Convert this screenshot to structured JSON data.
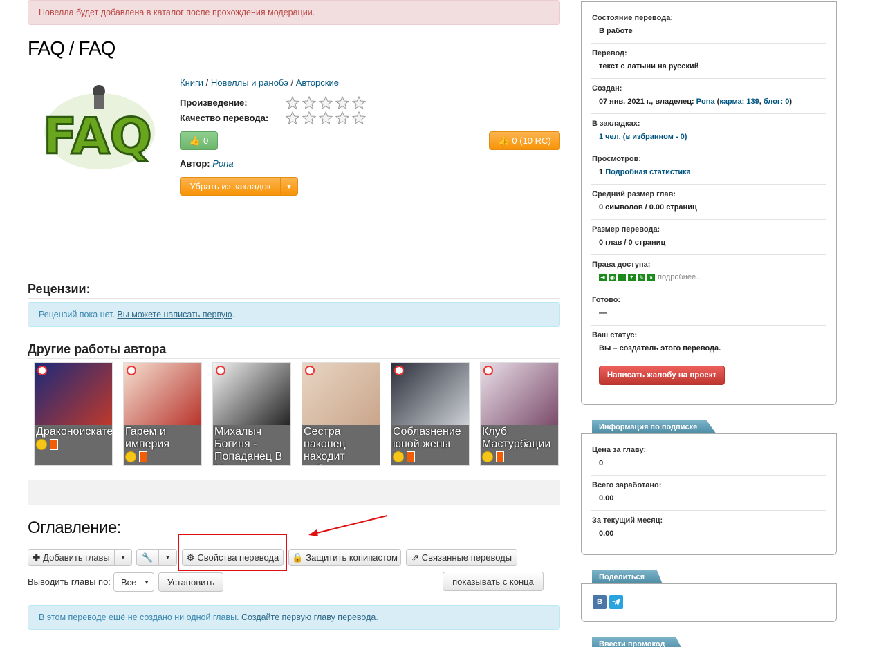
{
  "alerts": {
    "moderation": "Новелла будет добавлена в каталог после прохождения модерации.",
    "reviews_text": "Рецензий пока нет.",
    "reviews_link": "Вы можете написать первую",
    "reviews_end": ".",
    "chapters_text": "В этом переводе ещё не создано ни одной главы.",
    "chapters_link": "Создайте первую главу перевода",
    "chapters_end": "."
  },
  "title": "FAQ / FAQ",
  "breadcrumbs": {
    "c1": "Книги",
    "sep1": " / ",
    "c2": "Новеллы и ранобэ",
    "sep2": " / ",
    "c3": "Авторские"
  },
  "ratings": {
    "work_label": "Произведение:",
    "quality_label": "Качество перевода:"
  },
  "buttons": {
    "like": "0",
    "rc": "0 (10 RC)",
    "bookmark": "Убрать из закладок",
    "add_chapters": "Добавить главы",
    "properties": "Свойства перевода",
    "protect": "Защитить копипастом",
    "related": "Связанные переводы",
    "install": "Установить",
    "from_end": "показывать с конца",
    "complaint": "Написать жалобу на проект"
  },
  "author": {
    "label": "Автор:",
    "name": "Pona"
  },
  "sections": {
    "reviews": "Рецензии:",
    "other_works": "Другие работы автора",
    "toc": "Оглавление:"
  },
  "works": [
    {
      "title": "Драконоискатель",
      "colors": [
        "#1b2a7a",
        "#c0392b"
      ]
    },
    {
      "title": "Гарем и империя",
      "colors": [
        "#f4e1d2",
        "#b8322a"
      ]
    },
    {
      "title": "Михалыч Богиня - Попаданец В Мире",
      "colors": [
        "#f2f2f2",
        "#222222"
      ]
    },
    {
      "title": "Сестра наконец находит работу",
      "colors": [
        "#e8d5c4",
        "#c9a58a"
      ]
    },
    {
      "title": "Соблазнение юной жены",
      "colors": [
        "#2c2f3a",
        "#cfd3d8"
      ]
    },
    {
      "title": "Клуб Мастурбации",
      "colors": [
        "#e9dfe8",
        "#7a4a6a"
      ]
    }
  ],
  "toc": {
    "show_by_label": "Выводить главы по:",
    "show_by_value": "Все"
  },
  "sidebar": {
    "status_label": "Состояние перевода:",
    "status_value": "В работе",
    "translation_label": "Перевод:",
    "translation_value": "текст с латыни на русский",
    "created_label": "Создан:",
    "created_date": "07 янв. 2021 г., владелец: ",
    "created_owner": "Pona",
    "created_open": " (",
    "created_karma": "карма: 139",
    "created_comma": ", ",
    "created_blog": "блог: 0",
    "created_close": ")",
    "bookmarks_label": "В закладках:",
    "bookmarks_value": "1 чел. (в избранном - 0)",
    "views_label": "Просмотров:",
    "views_count": "1",
    "views_link": "Подробная статистика",
    "avg_label": "Средний размер глав:",
    "avg_value": "0 символов / 0.00 страниц",
    "size_label": "Размер перевода:",
    "size_value": "0 глав / 0 страниц",
    "rights_label": "Права доступа:",
    "rights_more": "подробнее...",
    "ready_label": "Готово:",
    "ready_value": "—",
    "your_status_label": "Ваш статус:",
    "your_status_value": "Вы – создатель этого перевода."
  },
  "subscription": {
    "header": "Информация по подписке",
    "price_label": "Цена за главу:",
    "price_value": "0",
    "total_label": "Всего заработано:",
    "total_value": "0.00",
    "month_label": "За текущий месяц:",
    "month_value": "0.00"
  },
  "share": {
    "header": "Поделиться",
    "vk": "В"
  },
  "promo": {
    "header": "Ввести промокод"
  },
  "colors": {
    "accent_orange": "#f89406",
    "green": "#6cb56c",
    "red_button": "#bd362f",
    "link": "#005580",
    "annotation": "#e01010"
  }
}
